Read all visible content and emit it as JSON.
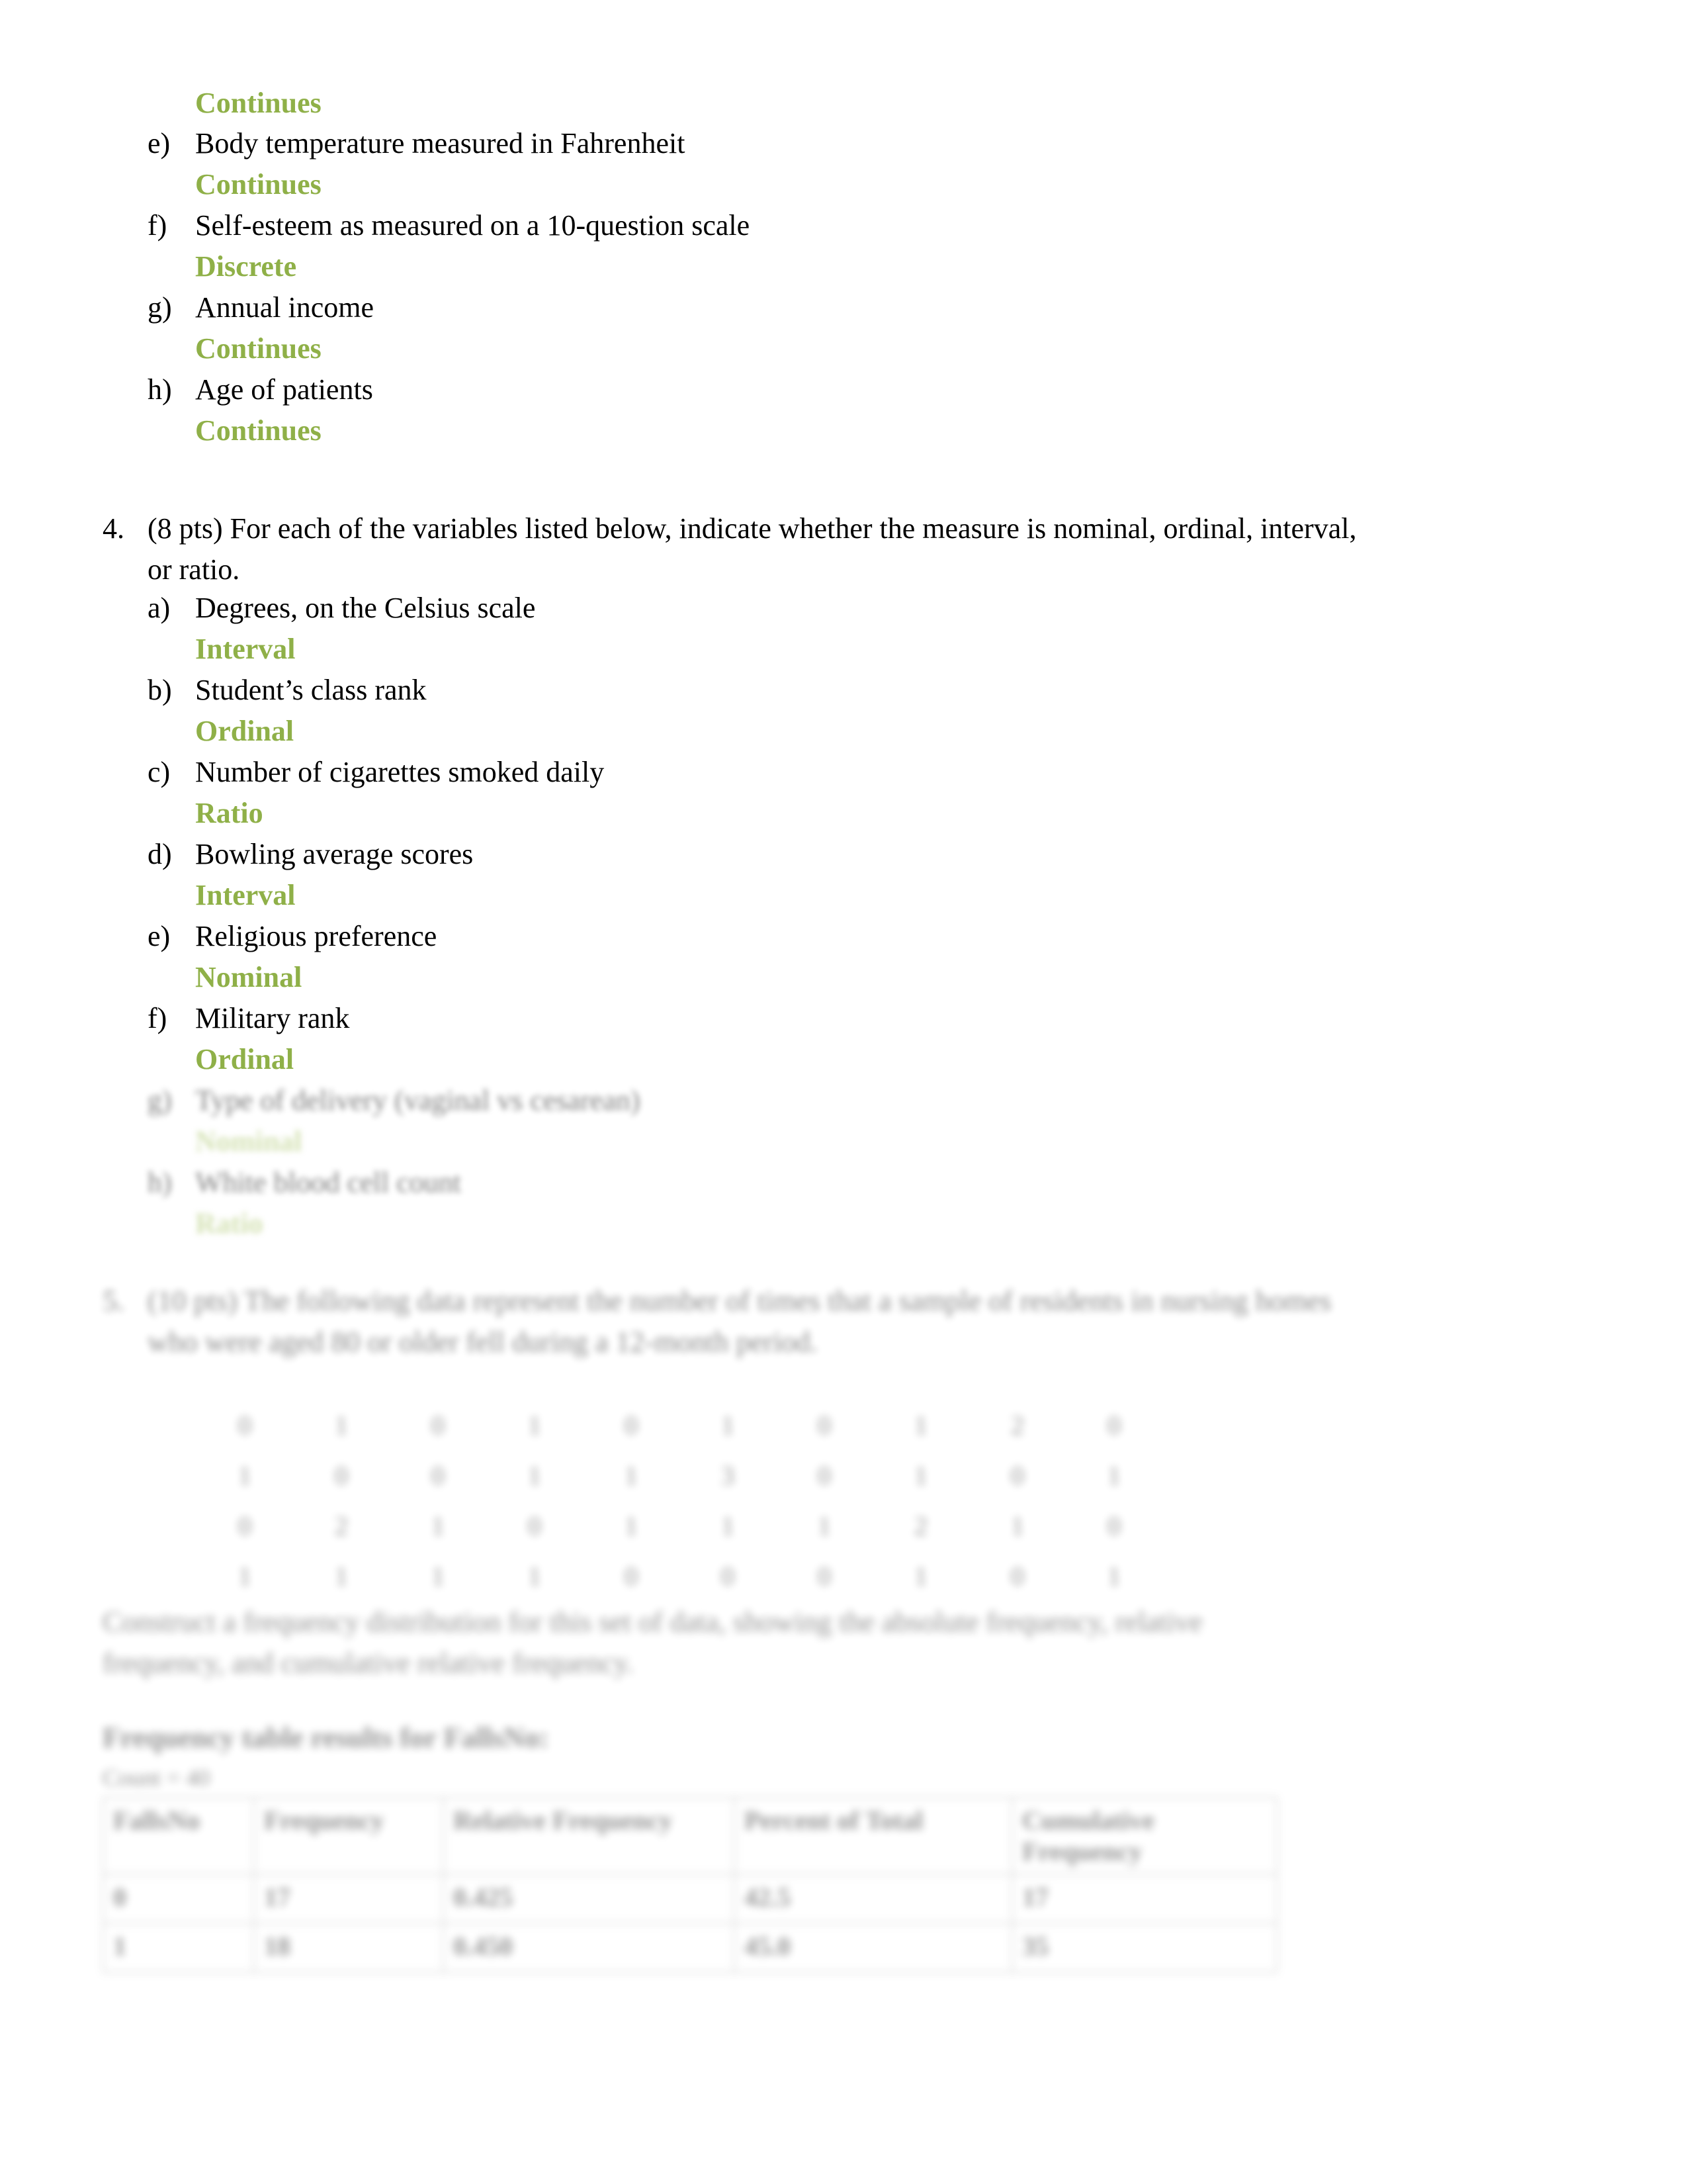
{
  "document": {
    "page_background": "#ffffff",
    "answer_color": "#8fb048"
  },
  "question3_tail": {
    "leading_answer": "Continues",
    "items": [
      {
        "marker": "e)",
        "text": "Body temperature measured in Fahrenheit",
        "answer": "Continues"
      },
      {
        "marker": "f)",
        "text": "Self-esteem as measured on a 10-question scale",
        "answer": "Discrete"
      },
      {
        "marker": "g)",
        "text": "Annual income",
        "answer": "Continues"
      },
      {
        "marker": "h)",
        "text": "Age of patients",
        "answer": "Continues"
      }
    ]
  },
  "question4": {
    "number": "4.",
    "prompt_line1": "(8 pts) For each of the variables listed below, indicate whether the measure is nominal, ordinal, interval,",
    "prompt_line2": "or ratio.",
    "items": [
      {
        "marker": "a)",
        "text": "Degrees, on the Celsius scale",
        "answer": "Interval"
      },
      {
        "marker": "b)",
        "text": "Student’s class rank",
        "answer": "Ordinal"
      },
      {
        "marker": "c)",
        "text": "Number of cigarettes smoked daily",
        "answer": "Ratio"
      },
      {
        "marker": "d)",
        "text": "Bowling average scores",
        "answer": "Interval"
      },
      {
        "marker": "e)",
        "text": "Religious preference",
        "answer": "Nominal"
      },
      {
        "marker": "f)",
        "text": "Military rank",
        "answer": "Ordinal"
      },
      {
        "marker": "g)",
        "text": "Type of delivery (vaginal vs cesarean)",
        "answer": "Nominal"
      },
      {
        "marker": "h)",
        "text": "White blood cell count",
        "answer": "Ratio"
      }
    ]
  },
  "question5": {
    "number": "5.",
    "prompt_line1": "(10 pts) The following data represent the number of times that a sample of residents in nursing homes",
    "prompt_line2": "who were aged 80 or older fell during a 12-month period.",
    "data_values": [
      "0",
      "1",
      "0",
      "1",
      "0",
      "1",
      "0",
      "1",
      "2",
      "0",
      "1",
      "0",
      "0",
      "1",
      "1",
      "3",
      "0",
      "1",
      "0",
      "1",
      "0",
      "2",
      "1",
      "0",
      "1",
      "1",
      "1",
      "2",
      "1",
      "0",
      "1",
      "1",
      "1",
      "1",
      "0",
      "0",
      "0",
      "1",
      "0",
      "1"
    ],
    "instruction_line1": "Construct a frequency distribution for this set of data, showing the absolute frequency, relative",
    "instruction_line2": "frequency, and cumulative relative frequency.",
    "results_caption": "Frequency table results for FallsNo:",
    "count_label": "Count = 40",
    "table": {
      "headers": [
        "FallsNo",
        "Frequency",
        "Relative Frequency",
        "Percent of Total",
        "Cumulative Frequency"
      ],
      "rows": [
        [
          "0",
          "17",
          "0.425",
          "42.5",
          "17"
        ],
        [
          "1",
          "18",
          "0.450",
          "45.0",
          "35"
        ]
      ]
    }
  }
}
